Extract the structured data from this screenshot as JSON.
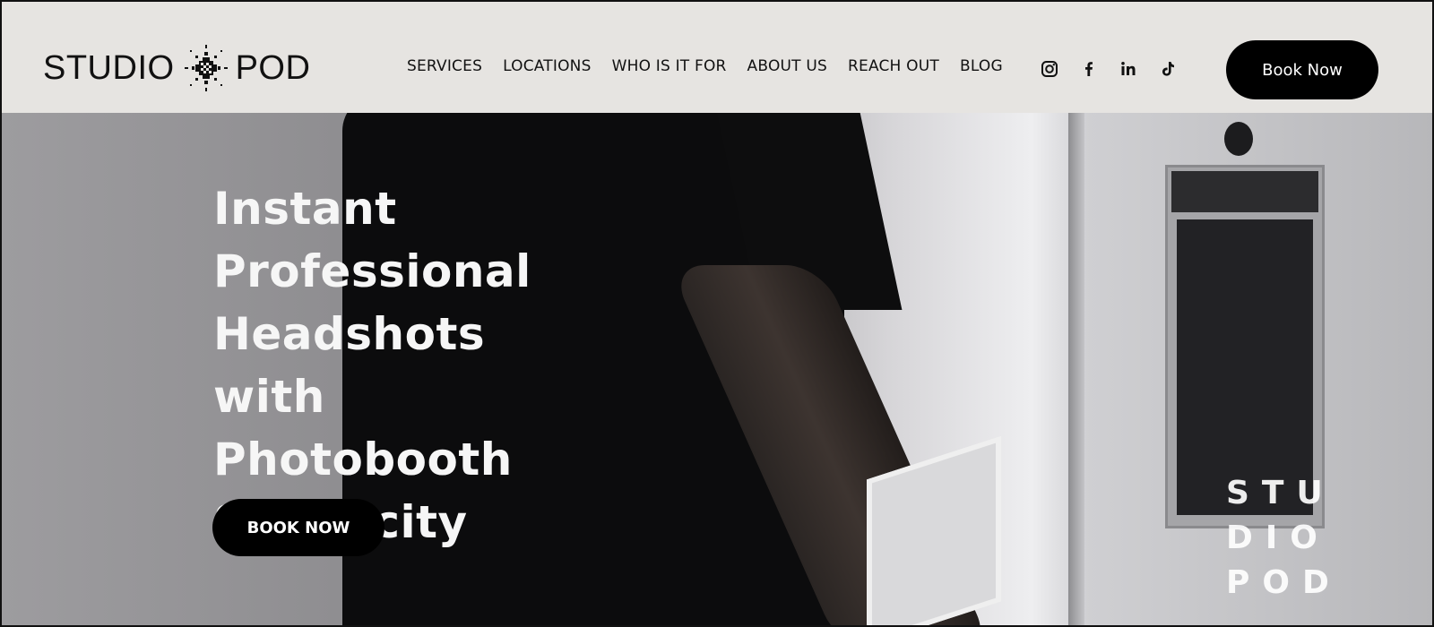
{
  "brand": {
    "logo_left": "STUDIO",
    "logo_right": "POD"
  },
  "nav": {
    "items": [
      "SERVICES",
      "LOCATIONS",
      "WHO IS IT FOR",
      "ABOUT US",
      "REACH OUT",
      "BLOG"
    ]
  },
  "social": {
    "icons": [
      "instagram-icon",
      "facebook-icon",
      "linkedin-icon",
      "tiktok-icon"
    ]
  },
  "header": {
    "book_button": "Book Now"
  },
  "hero": {
    "title_lines": [
      "Instant",
      "Professional",
      "Headshots with",
      "Photobooth",
      "Simplicity"
    ],
    "cta_button": "BOOK NOW",
    "watermark_lines": [
      "STU",
      "DIO",
      "POD"
    ]
  },
  "colors": {
    "header_bg": "#e6e4e1",
    "button_bg": "#000000",
    "button_text": "#ffffff"
  }
}
